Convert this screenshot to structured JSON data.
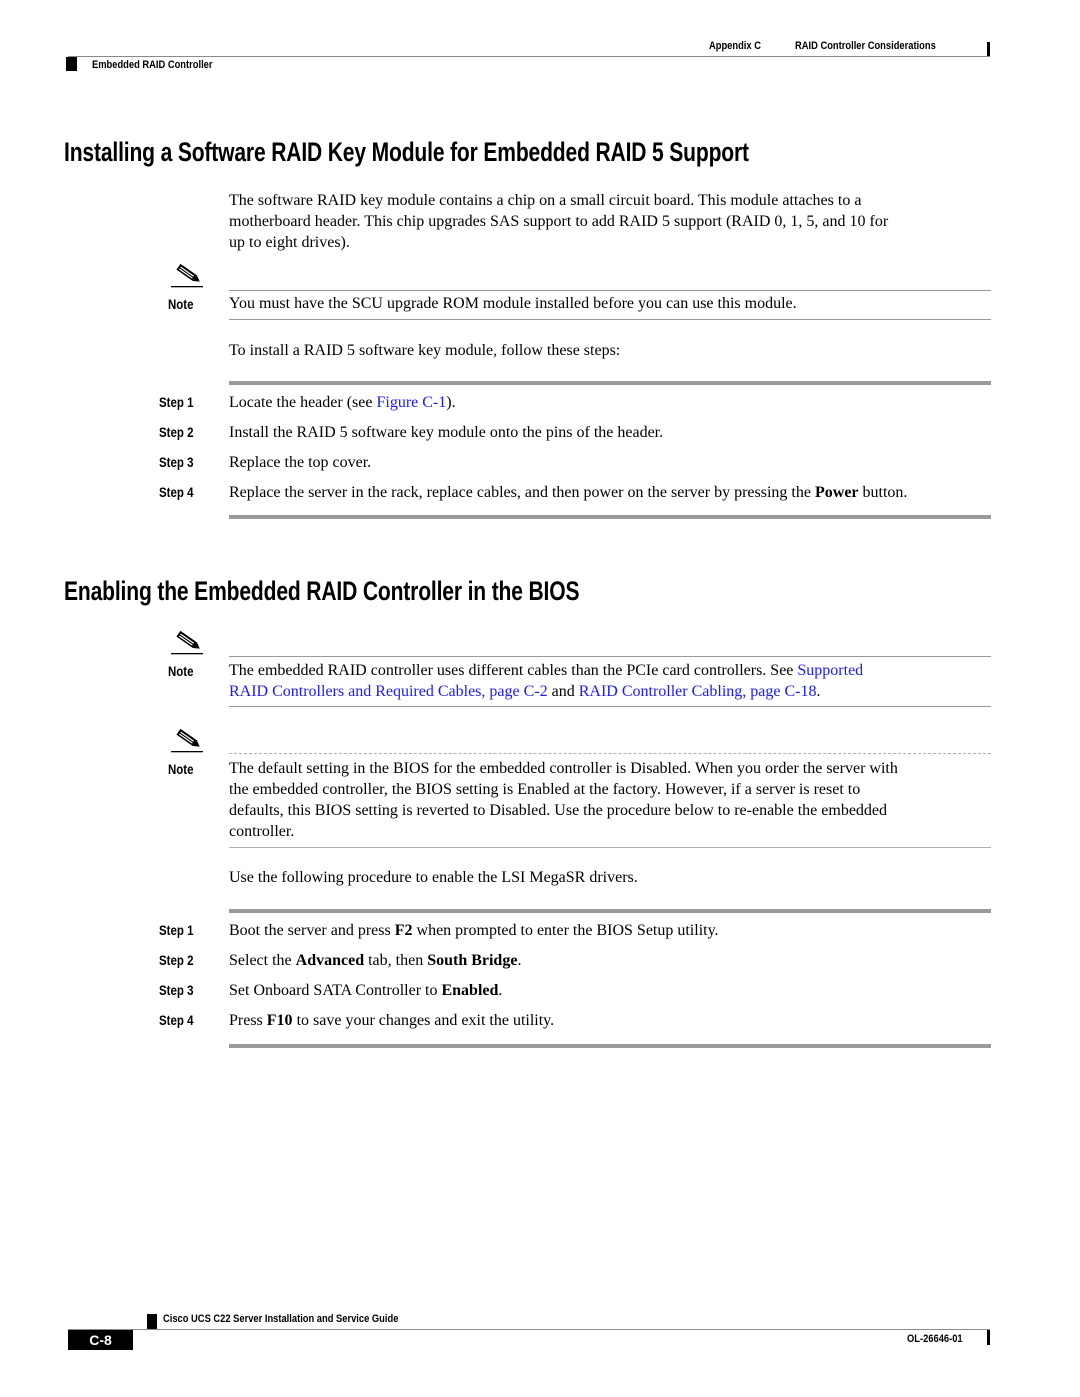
{
  "header": {
    "appendix": "Appendix C",
    "chapter_title": "RAID Controller Considerations",
    "section": "Embedded RAID Controller"
  },
  "section1": {
    "title": "Installing a Software RAID Key Module for Embedded RAID 5 Support",
    "intro": [
      "The software RAID key module contains a chip on a small circuit board. This module attaches to a",
      "motherboard header. This chip upgrades SAS support to add RAID 5 support (RAID 0, 1, 5, and 10 for",
      "up to eight drives)."
    ],
    "note_label": "Note",
    "note_text": "You must have the SCU upgrade ROM module installed before you can use this module.",
    "procedure_intro": "To install a RAID 5 software key module, follow these steps:",
    "steps": [
      {
        "label": "Step 1",
        "pre": "Locate the header (see ",
        "link": "Figure C-1",
        "post": ")."
      },
      {
        "label": "Step 2",
        "text": "Install the RAID 5 software key module onto the pins of the header."
      },
      {
        "label": "Step 3",
        "text": "Replace the top cover."
      },
      {
        "label": "Step 4",
        "pre": "Replace the server in the rack, replace cables, and then power on the server by pressing the ",
        "bold": "Power",
        "post": " button."
      }
    ]
  },
  "section2": {
    "title": "Enabling the Embedded RAID Controller in the BIOS",
    "note1_label": "Note",
    "note1_line1_pre": "The embedded RAID controller uses different cables than the PCIe card controllers. See ",
    "note1_link1_part1": "Supported",
    "note1_link1_part2": "RAID Controllers and Required Cables, page C-2",
    "note1_mid": " and ",
    "note1_link2": "RAID Controller Cabling, page C-18",
    "note1_end": ".",
    "note2_label": "Note",
    "note2_lines": [
      "The default setting in the BIOS for the embedded controller is Disabled. When you order the server with",
      "the embedded controller, the BIOS setting is Enabled at the factory. However, if a server is reset to",
      "defaults, this BIOS setting is reverted to Disabled. Use the procedure below to re-enable the embedded",
      "controller."
    ],
    "procedure_intro": "Use the following procedure to enable the LSI MegaSR drivers.",
    "steps": [
      {
        "label": "Step 1",
        "pre": "Boot the server and press ",
        "bold": "F2",
        "post": " when prompted to enter the BIOS Setup utility."
      },
      {
        "label": "Step 2",
        "pre": "Select the ",
        "bold": "Advanced",
        "mid": " tab, then ",
        "bold2": "South Bridge",
        "post": "."
      },
      {
        "label": "Step 3",
        "pre": "Set Onboard SATA Controller to ",
        "bold": "Enabled",
        "post": "."
      },
      {
        "label": "Step 4",
        "pre": "Press ",
        "bold": "F10",
        "post": " to save your changes and exit the utility."
      }
    ]
  },
  "footer": {
    "guide_title": "Cisco UCS C22 Server Installation and Service Guide",
    "page_number": "C-8",
    "doc_number": "OL-26646-01"
  }
}
